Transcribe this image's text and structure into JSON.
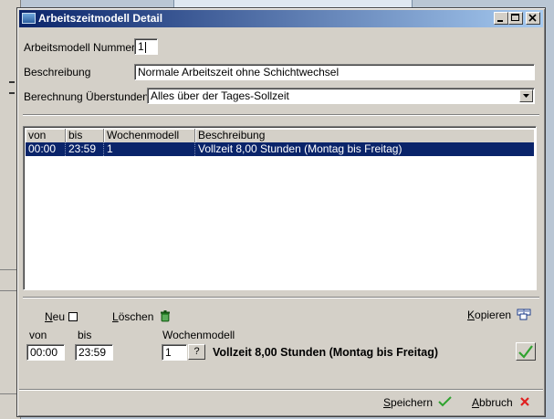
{
  "window": {
    "title": "Arbeitszeitmodell Detail"
  },
  "form": {
    "nummer_label": "Arbeitsmodell Nummer",
    "nummer_value": "1",
    "beschreibung_label": "Beschreibung",
    "beschreibung_value": "Normale Arbeitszeit ohne Schichtwechsel",
    "berechnung_label": "Berechnung Überstunden",
    "berechnung_value": "Alles über der Tages-Sollzeit"
  },
  "table": {
    "columns": [
      "von",
      "bis",
      "Wochenmodell",
      "Beschreibung"
    ],
    "rows": [
      {
        "von": "00:00",
        "bis": "23:59",
        "wochenmodell": "1",
        "beschreibung": "Vollzeit 8,00 Stunden (Montag bis Freitag)"
      }
    ]
  },
  "actions": {
    "neu_first": "N",
    "neu_rest": "eu",
    "loeschen_first": "L",
    "loeschen_rest": "öschen",
    "kopieren_first": "K",
    "kopieren_rest": "opieren"
  },
  "detail": {
    "von_label": "von",
    "bis_label": "bis",
    "wochenmodell_label": "Wochenmodell",
    "von_value": "00:00",
    "bis_value": "23:59",
    "wochenmodell_value": "1",
    "lookup_label": "?",
    "wochenmodell_text": "Vollzeit 8,00 Stunden (Montag bis Freitag)"
  },
  "footer": {
    "speichern_first": "S",
    "speichern_rest": "peichern",
    "abbruch_first": "A",
    "abbruch_rest": "bbruch"
  },
  "colors": {
    "title_start": "#0a246a",
    "title_end": "#a6caf0",
    "selection": "#0a246a",
    "ok_green": "#2fa32f",
    "cancel_red": "#e02020",
    "delete_green": "#2e8b2e"
  }
}
